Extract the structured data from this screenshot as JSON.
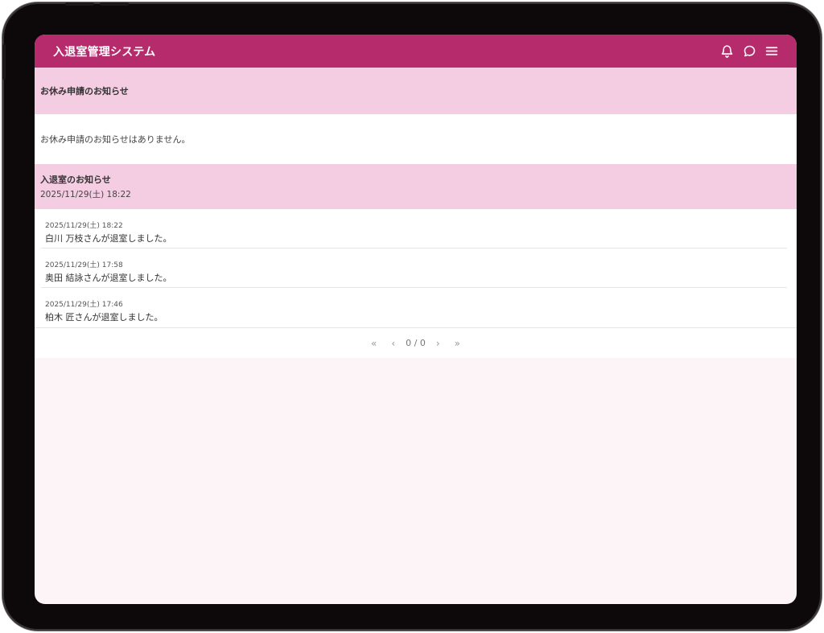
{
  "app": {
    "title": "入退室管理システム",
    "accent_color": "#b52b6c",
    "icons": [
      "bell-icon",
      "chat-icon",
      "menu-icon"
    ]
  },
  "leave_notice": {
    "title": "お休み申請のお知らせ",
    "empty_message": "お休み申請のお知らせはありません。"
  },
  "entry_notice": {
    "title": "入退室のお知らせ",
    "updated": "2025/11/29(土) 18:22",
    "items": [
      {
        "time": "2025/11/29(土) 18:22",
        "message": "白川 万枝さんが退室しました。"
      },
      {
        "time": "2025/11/29(土) 17:58",
        "message": "奥田 結詠さんが退室しました。"
      },
      {
        "time": "2025/11/29(土) 17:46",
        "message": "柏木 匠さんが退室しました。"
      }
    ]
  },
  "pagination": {
    "first": "«",
    "prev": "‹",
    "info": "0 / 0",
    "next": "›",
    "last": "»"
  }
}
